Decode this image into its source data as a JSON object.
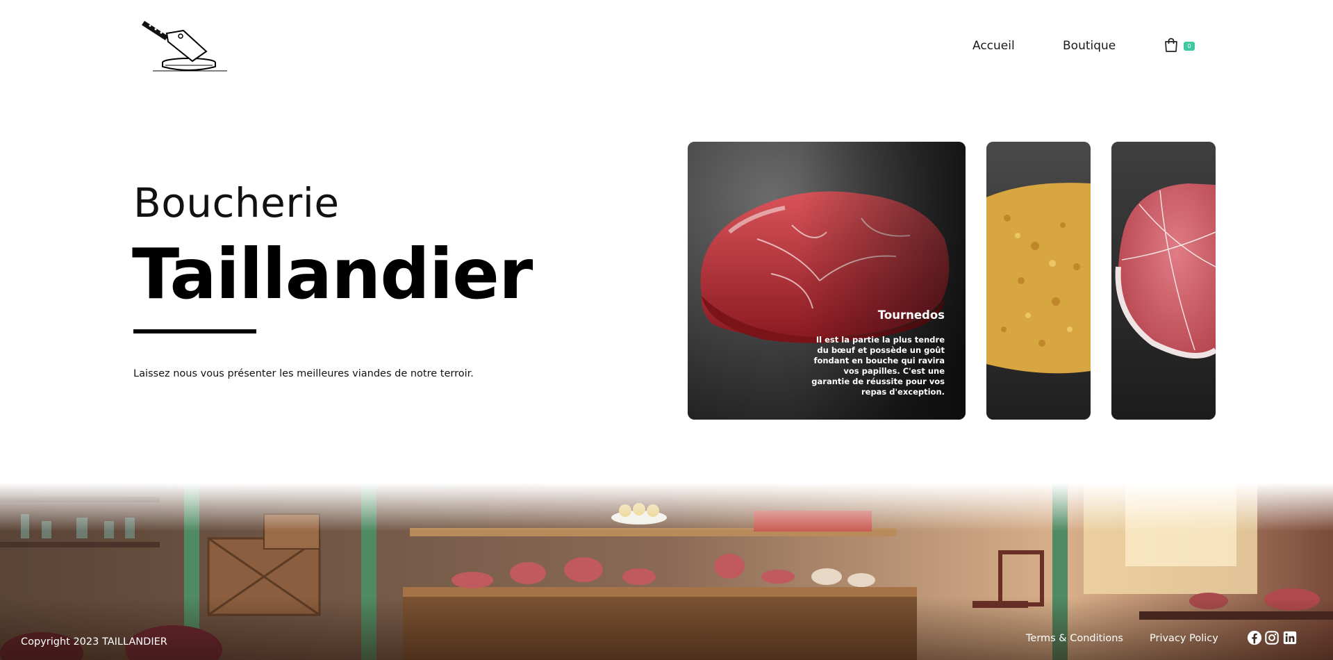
{
  "header": {
    "logo_icon": "cleaver-on-block-icon",
    "nav": {
      "accueil": "Accueil",
      "boutique": "Boutique"
    },
    "cart": {
      "icon": "shopping-bag-icon",
      "count": "0",
      "badge_color": "#3fc9a0"
    }
  },
  "hero": {
    "subtitle": "Boucherie",
    "title": "Taillandier",
    "description": "Laissez nous vous présenter les meilleures viandes de notre terroir."
  },
  "cards": [
    {
      "title": "Tournedos",
      "text": "Il est la partie la plus tendre du bœuf et possède un goût fondant en bouche qui ravira vos papilles. C'est une garantie de réussite pour vos repas d'exception.",
      "image": "raw-beef-steak"
    },
    {
      "image": "breaded-cutlet"
    },
    {
      "image": "tied-beef-roast"
    }
  ],
  "footer": {
    "copyright": "Copyright 2023 TAILLANDIER",
    "terms": "Terms & Conditions",
    "privacy": "Privacy Policy",
    "social_icons": [
      "facebook-icon",
      "instagram-icon",
      "linkedin-icon"
    ]
  }
}
